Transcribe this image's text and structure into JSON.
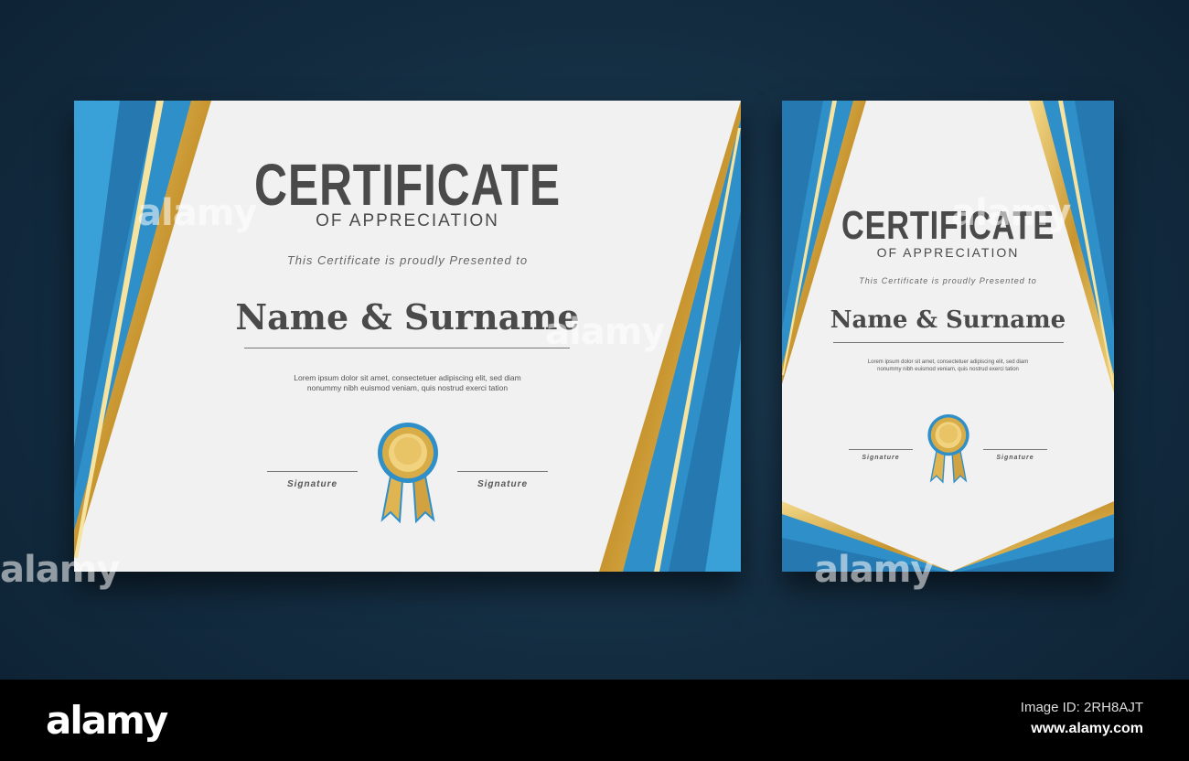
{
  "certificates": [
    {
      "title": "CERTIFICATE",
      "subtitle": "OF APPRECIATION",
      "presented": "This Certificate is proudly Presented to",
      "name": "Name & Surname",
      "lorem1": "Lorem ipsum dolor sit amet, consectetuer adipiscing elit, sed diam",
      "lorem2": "nonummy nibh euismod veniam, quis nostrud exerci tation",
      "sig_left": "Signature",
      "sig_right": "Signature"
    },
    {
      "title": "CERTIFICATE",
      "subtitle": "OF APPRECIATION",
      "presented": "This Certificate is proudly Presented to",
      "name": "Name & Surname",
      "lorem1": "Lorem ipsum dolor sit amet, consectetuer adipiscing elit, sed diam",
      "lorem2": "nonummy nibh euismod veniam, quis nostrud exerci tation",
      "sig_left": "Signature",
      "sig_right": "Signature"
    }
  ],
  "watermark": "alamy",
  "footer": {
    "logo": "alamy",
    "image_id": "Image ID: 2RH8AJT",
    "url": "www.alamy.com"
  },
  "colors": {
    "blue": "#2f8fc8",
    "gold": "#d4a843",
    "background": "#132c40"
  }
}
